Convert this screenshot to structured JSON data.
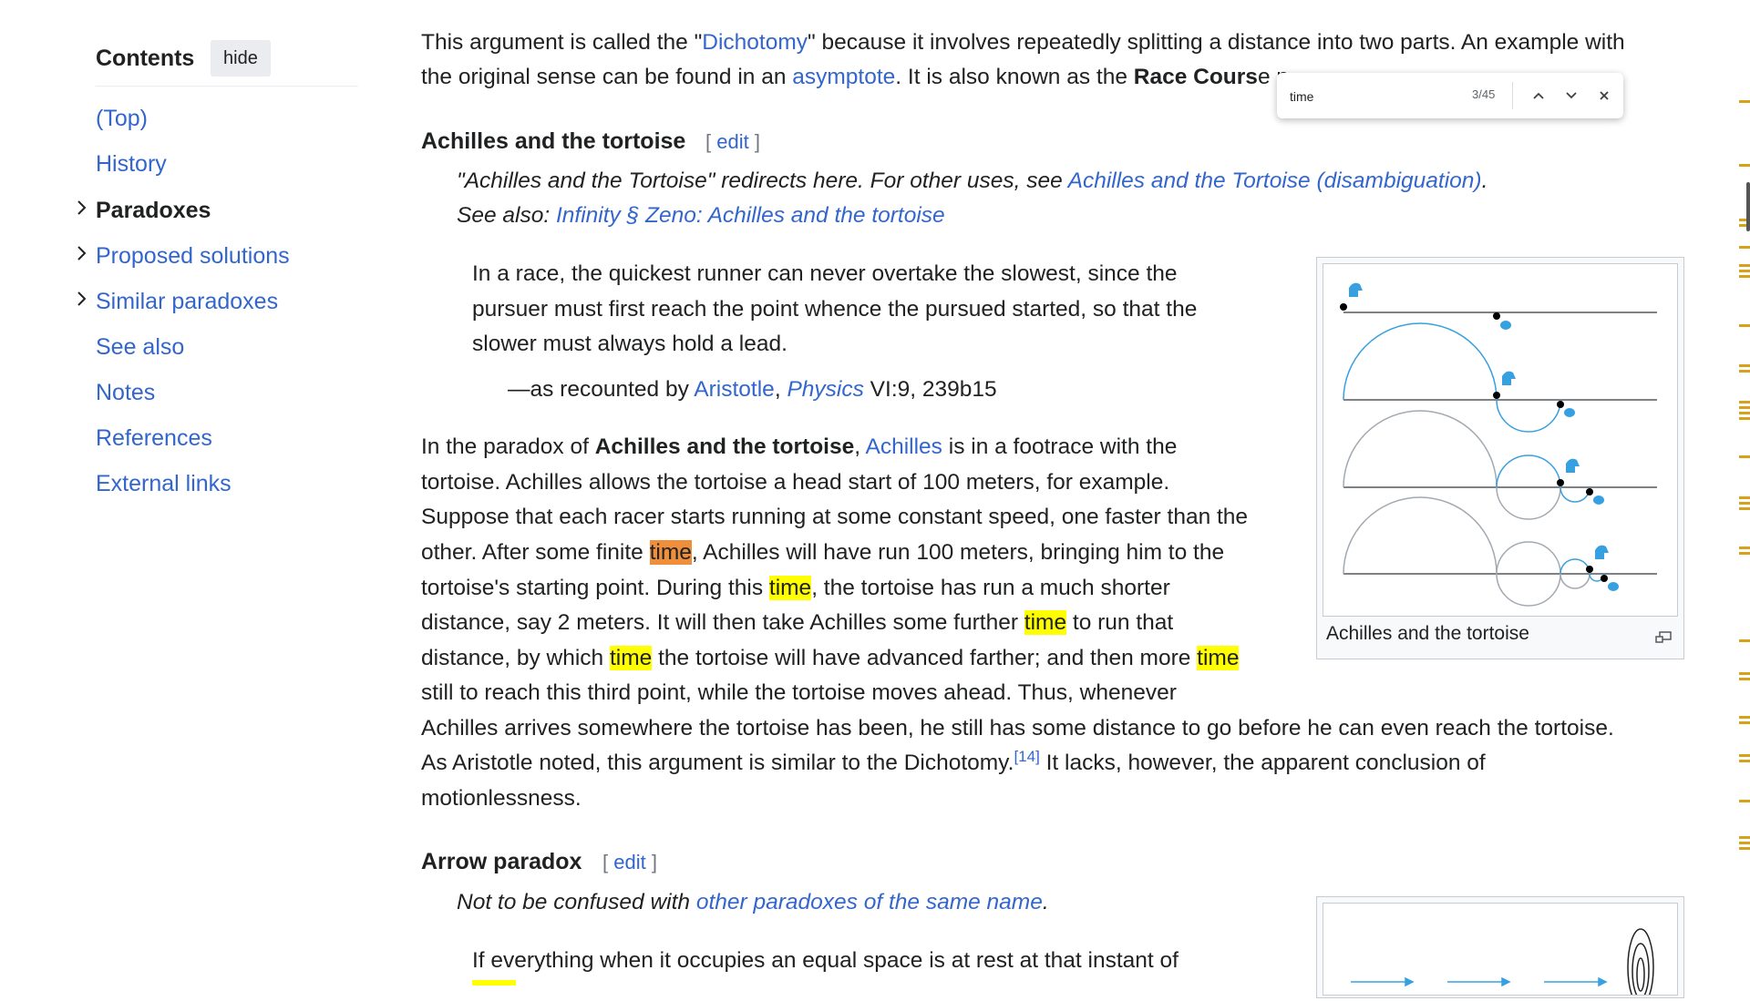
{
  "toc": {
    "title": "Contents",
    "hide_label": "hide",
    "items": [
      {
        "label": "(Top)"
      },
      {
        "label": "History"
      },
      {
        "label": "Paradoxes"
      },
      {
        "label": "Proposed solutions"
      },
      {
        "label": "Similar paradoxes"
      },
      {
        "label": "See also"
      },
      {
        "label": "Notes"
      },
      {
        "label": "References"
      },
      {
        "label": "External links"
      }
    ]
  },
  "intro": {
    "l1_a": "This argument is called the \"",
    "l1_link": "Dichotomy",
    "l1_b": "\" because it involves repeatedly splitting a distance into two parts. An example with",
    "l2_a": "the original sense can be found in an ",
    "l2_link": "asymptote",
    "l2_b": ". It is also known as the ",
    "l2_bold": "Race Cours",
    "l2_c": "e p"
  },
  "achilles": {
    "heading": "Achilles and the tortoise",
    "edit_open": "[ ",
    "edit_label": "edit",
    "edit_close": " ]",
    "hat1_a": "\"Achilles and the Tortoise\" redirects here. For other uses, see ",
    "hat1_link": "Achilles and the Tortoise (disambiguation)",
    "hat1_b": ".",
    "hat2_a": "See also: ",
    "hat2_link": "Infinity § Zeno: Achilles and the tortoise",
    "quote_l1": "In a race, the quickest runner can never overtake the slowest, since the",
    "quote_l2": "pursuer must first reach the point whence the pursued started, so that the",
    "quote_l3": "slower must always hold a lead.",
    "cite_a": "—as recounted by ",
    "cite_link1": "Aristotle",
    "cite_b": ", ",
    "cite_link2": "Physics",
    "cite_c": " VI:9, 239b15",
    "p1_a": "In the paradox of ",
    "p1_bold": "Achilles and the tortoise",
    "p1_b": ", ",
    "p1_link": "Achilles",
    "p1_c": " is in a footrace with the",
    "p2": "tortoise. Achilles allows the tortoise a head start of 100 meters, for example.",
    "p3": "Suppose that each racer starts running at some constant speed, one faster than the",
    "p4_a": "other. After some finite ",
    "p4_hl": "time",
    "p4_b": ", Achilles will have run 100 meters, bringing him to the",
    "p5_a": "tortoise's starting point. During this ",
    "p5_hl": "time",
    "p5_b": ", the tortoise has run a much shorter",
    "p6_a": "distance, say 2 meters. It will then take Achilles some further ",
    "p6_hl": "time",
    "p6_b": " to run that",
    "p7_a": "distance, by which ",
    "p7_hl": "time",
    "p7_b": " the tortoise will have advanced farther; and then more ",
    "p7_hl2": "time",
    "p8": "still to reach this third point, while the tortoise moves ahead. Thus, whenever",
    "p9": "Achilles arrives somewhere the tortoise has been, he still has some distance to go before he can even reach the tortoise.",
    "p10_a": "As Aristotle noted, this argument is similar to the Dichotomy.",
    "p10_ref": "[14]",
    "p10_b": " It lacks, however, the apparent conclusion of",
    "p11": "motionlessness.",
    "figure_caption": "Achilles and the tortoise"
  },
  "arrow": {
    "heading": "Arrow paradox",
    "edit_open": "[ ",
    "edit_label": "edit",
    "edit_close": " ]",
    "hat_a": "Not to be confused with ",
    "hat_link": "other paradoxes of the same name",
    "hat_b": ".",
    "quote_l1": "If everything when it occupies an equal space is at rest at that instant of"
  },
  "findbar": {
    "query": "time",
    "count": "3/45",
    "prev_icon": "chevron-up-icon",
    "next_icon": "chevron-down-icon",
    "close_icon": "close-icon"
  },
  "colors": {
    "link": "#3366cc",
    "match_highlight": "#ffff00",
    "current_match": "#ef8f3c",
    "scroll_marker": "#d6a21a"
  }
}
